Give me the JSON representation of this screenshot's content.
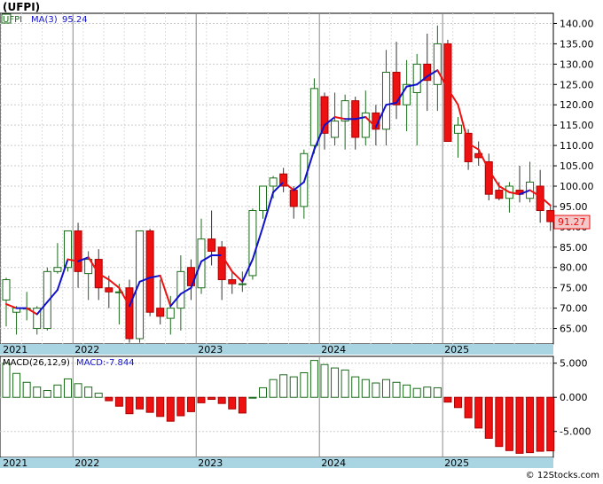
{
  "chart_title": "(UFPI)",
  "credit": "© 12Stocks.com",
  "price_panel": {
    "symbol_label": "UFPI",
    "ma_label": "MA(3)",
    "ma_value": "95.24",
    "last_price_label": "91.27",
    "y_ticks": [
      "140.00",
      "135.00",
      "130.00",
      "125.00",
      "120.00",
      "115.00",
      "110.00",
      "105.00",
      "100.00",
      "95.00",
      "90.00",
      "85.00",
      "80.00",
      "75.00",
      "70.00",
      "65.00"
    ],
    "x_labels": [
      "2021",
      "2022",
      "2023",
      "2024",
      "2025"
    ]
  },
  "macd_panel": {
    "label": "MACD(26,12,9)",
    "value_label": "MACD:-7.844",
    "y_ticks": [
      "5.000",
      "0.000",
      "-5.000"
    ],
    "x_labels": [
      "2021",
      "2022",
      "2023",
      "2024",
      "2025"
    ]
  },
  "colors": {
    "up_candle": "#1a6b1a",
    "down_candle": "#ee1111",
    "ma_rising": "#1111cc",
    "ma_falling": "#ee1111",
    "macd_pos": "#1a6b1a",
    "macd_neg": "#ee1111",
    "axis_band": "#a9d4e2",
    "last_price_box": "#f3c8c8"
  },
  "chart_data": {
    "type": "candlestick",
    "price_range": [
      61.2,
      142.5
    ],
    "macd_range": [
      -8.8,
      6.0
    ],
    "bars": [
      {
        "o": 72.0,
        "h": 77.5,
        "l": 65.5,
        "c": 77.0,
        "ma": 71.0,
        "m": 5.0
      },
      {
        "o": 69.0,
        "h": 70.5,
        "l": 63.5,
        "c": 70.0,
        "ma": 70.0,
        "m": 3.5
      },
      {
        "o": 70.0,
        "h": 74.0,
        "l": 67.0,
        "c": 70.0,
        "ma": 70.0,
        "m": 2.2
      },
      {
        "o": 65.0,
        "h": 70.5,
        "l": 63.5,
        "c": 70.0,
        "ma": 68.5,
        "m": 1.5
      },
      {
        "o": 65.0,
        "h": 80.0,
        "l": 64.5,
        "c": 79.0,
        "ma": 71.5,
        "m": 1.0
      },
      {
        "o": 79.0,
        "h": 86.0,
        "l": 78.5,
        "c": 80.0,
        "ma": 74.5,
        "m": 1.8
      },
      {
        "o": 80.0,
        "h": 89.0,
        "l": 79.0,
        "c": 89.0,
        "ma": 82.0,
        "m": 2.7
      },
      {
        "o": 89.0,
        "h": 91.0,
        "l": 75.0,
        "c": 79.0,
        "ma": 81.5,
        "m": 2.0
      },
      {
        "o": 78.5,
        "h": 84.0,
        "l": 72.0,
        "c": 82.0,
        "ma": 82.5,
        "m": 1.5
      },
      {
        "o": 82.0,
        "h": 84.5,
        "l": 72.0,
        "c": 75.0,
        "ma": 78.5,
        "m": 0.6
      },
      {
        "o": 75.0,
        "h": 78.0,
        "l": 70.0,
        "c": 74.0,
        "ma": 77.0,
        "m": -0.5
      },
      {
        "o": 74.0,
        "h": 76.0,
        "l": 66.0,
        "c": 74.0,
        "ma": 75.0,
        "m": -1.3
      },
      {
        "o": 75.0,
        "h": 77.0,
        "l": 61.5,
        "c": 62.5,
        "ma": 70.5,
        "m": -2.4
      },
      {
        "o": 62.5,
        "h": 89.0,
        "l": 61.5,
        "c": 89.0,
        "ma": 76.5,
        "m": -1.7
      },
      {
        "o": 89.0,
        "h": 89.5,
        "l": 68.0,
        "c": 69.0,
        "ma": 77.5,
        "m": -2.2
      },
      {
        "o": 70.0,
        "h": 77.0,
        "l": 66.0,
        "c": 68.0,
        "ma": 78.0,
        "m": -2.8
      },
      {
        "o": 67.5,
        "h": 73.0,
        "l": 63.5,
        "c": 70.0,
        "ma": 70.5,
        "m": -3.5
      },
      {
        "o": 70.0,
        "h": 83.0,
        "l": 64.5,
        "c": 79.0,
        "ma": 73.5,
        "m": -2.7
      },
      {
        "o": 80.0,
        "h": 82.0,
        "l": 72.0,
        "c": 75.5,
        "ma": 75.0,
        "m": -2.1
      },
      {
        "o": 75.0,
        "h": 92.0,
        "l": 73.5,
        "c": 87.0,
        "ma": 81.5,
        "m": -0.8
      },
      {
        "o": 87.0,
        "h": 94.0,
        "l": 80.5,
        "c": 84.0,
        "ma": 83.0,
        "m": -0.3
      },
      {
        "o": 85.0,
        "h": 86.5,
        "l": 72.0,
        "c": 77.0,
        "ma": 83.0,
        "m": -0.9
      },
      {
        "o": 77.0,
        "h": 79.0,
        "l": 73.5,
        "c": 76.0,
        "ma": 79.0,
        "m": -1.7
      },
      {
        "o": 76.0,
        "h": 79.0,
        "l": 74.0,
        "c": 76.0,
        "ma": 76.5,
        "m": -2.3
      },
      {
        "o": 78.0,
        "h": 94.5,
        "l": 77.0,
        "c": 94.0,
        "ma": 82.0,
        "m": 0.0
      },
      {
        "o": 94.0,
        "h": 100.0,
        "l": 92.0,
        "c": 100.0,
        "ma": 90.0,
        "m": 1.4
      },
      {
        "o": 100.0,
        "h": 102.5,
        "l": 97.0,
        "c": 102.0,
        "ma": 98.5,
        "m": 2.6
      },
      {
        "o": 103.0,
        "h": 104.5,
        "l": 98.5,
        "c": 100.0,
        "ma": 101.0,
        "m": 3.3
      },
      {
        "o": 99.0,
        "h": 100.0,
        "l": 92.0,
        "c": 95.0,
        "ma": 99.0,
        "m": 3.0
      },
      {
        "o": 95.0,
        "h": 109.0,
        "l": 92.0,
        "c": 108.0,
        "ma": 101.0,
        "m": 3.6
      },
      {
        "o": 110.0,
        "h": 126.5,
        "l": 108.0,
        "c": 124.0,
        "ma": 109.0,
        "m": 5.4
      },
      {
        "o": 122.0,
        "h": 123.0,
        "l": 109.0,
        "c": 113.0,
        "ma": 115.0,
        "m": 4.8
      },
      {
        "o": 112.0,
        "h": 123.0,
        "l": 110.0,
        "c": 116.0,
        "ma": 117.0,
        "m": 4.3
      },
      {
        "o": 116.0,
        "h": 122.5,
        "l": 109.0,
        "c": 121.0,
        "ma": 116.5,
        "m": 4.0
      },
      {
        "o": 121.0,
        "h": 122.0,
        "l": 109.0,
        "c": 112.0,
        "ma": 116.5,
        "m": 3.0
      },
      {
        "o": 112.0,
        "h": 123.5,
        "l": 110.0,
        "c": 118.0,
        "ma": 117.0,
        "m": 2.6
      },
      {
        "o": 118.0,
        "h": 120.0,
        "l": 110.0,
        "c": 114.0,
        "ma": 114.5,
        "m": 2.1
      },
      {
        "o": 114.0,
        "h": 133.5,
        "l": 110.0,
        "c": 128.0,
        "ma": 120.0,
        "m": 2.6
      },
      {
        "o": 128.0,
        "h": 135.5,
        "l": 116.5,
        "c": 120.0,
        "ma": 120.5,
        "m": 2.2
      },
      {
        "o": 120.0,
        "h": 131.0,
        "l": 113.5,
        "c": 125.0,
        "ma": 124.5,
        "m": 1.8
      },
      {
        "o": 123.0,
        "h": 132.5,
        "l": 110.0,
        "c": 130.0,
        "ma": 125.0,
        "m": 1.3
      },
      {
        "o": 130.0,
        "h": 137.5,
        "l": 118.5,
        "c": 126.0,
        "ma": 127.0,
        "m": 1.5
      },
      {
        "o": 125.0,
        "h": 139.5,
        "l": 118.5,
        "c": 135.0,
        "ma": 128.5,
        "m": 1.4
      },
      {
        "o": 135.0,
        "h": 136.0,
        "l": 111.0,
        "c": 111.0,
        "ma": 124.0,
        "m": -0.7
      },
      {
        "o": 113.0,
        "h": 117.0,
        "l": 107.0,
        "c": 115.0,
        "ma": 120.0,
        "m": -1.5
      },
      {
        "o": 113.0,
        "h": 114.0,
        "l": 104.0,
        "c": 106.0,
        "ma": 110.5,
        "m": -3.0
      },
      {
        "o": 108.0,
        "h": 111.0,
        "l": 105.0,
        "c": 107.0,
        "ma": 109.0,
        "m": -4.5
      },
      {
        "o": 106.0,
        "h": 108.0,
        "l": 96.5,
        "c": 98.0,
        "ma": 104.0,
        "m": -6.0
      },
      {
        "o": 99.0,
        "h": 101.0,
        "l": 96.5,
        "c": 97.0,
        "ma": 100.0,
        "m": -7.2
      },
      {
        "o": 97.0,
        "h": 101.0,
        "l": 93.5,
        "c": 100.0,
        "ma": 98.5,
        "m": -7.8
      },
      {
        "o": 99.0,
        "h": 105.0,
        "l": 96.0,
        "c": 98.0,
        "ma": 98.0,
        "m": -8.2
      },
      {
        "o": 97.0,
        "h": 106.0,
        "l": 96.0,
        "c": 101.0,
        "ma": 99.0,
        "m": -8.1
      },
      {
        "o": 100.0,
        "h": 104.0,
        "l": 91.0,
        "c": 94.0,
        "ma": 97.5,
        "m": -7.9
      },
      {
        "o": 94.0,
        "h": 95.0,
        "l": 89.0,
        "c": 91.27,
        "ma": 95.24,
        "m": -7.844
      }
    ]
  }
}
